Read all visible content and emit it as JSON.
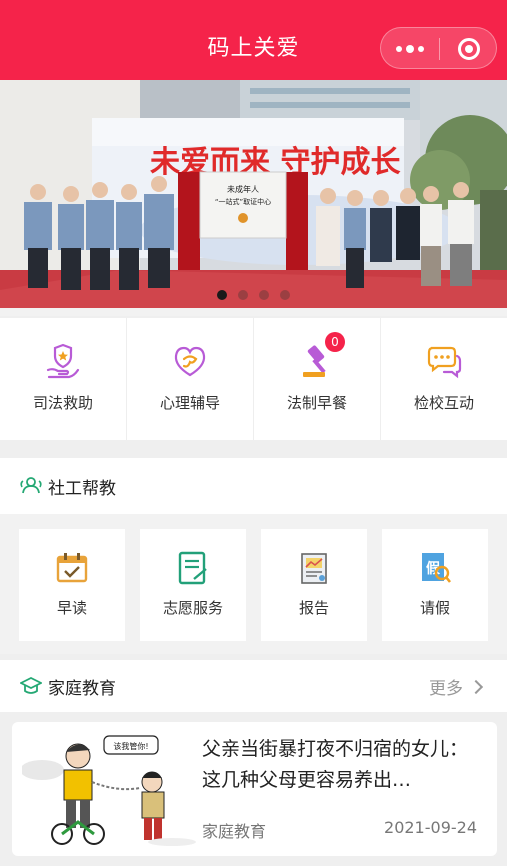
{
  "header": {
    "title": "码上关爱"
  },
  "banner": {
    "slogan": "未爱而来  守护成长",
    "board_line1": "未成年人",
    "board_line2": "“一站式”取证中心",
    "slide_count": 4,
    "active_slide": 1
  },
  "quick_menu": [
    {
      "label": "司法救助",
      "icon": "hand-heart-icon"
    },
    {
      "label": "心理辅导",
      "icon": "heart-chat-icon"
    },
    {
      "label": "法制早餐",
      "icon": "gavel-icon",
      "badge": "0"
    },
    {
      "label": "检校互动",
      "icon": "chat-bubbles-icon"
    }
  ],
  "social_work": {
    "title": "社工帮教",
    "items": [
      {
        "label": "早读",
        "icon": "calendar-icon"
      },
      {
        "label": "志愿服务",
        "icon": "form-icon"
      },
      {
        "label": "报告",
        "icon": "report-icon"
      },
      {
        "label": "请假",
        "icon": "leave-icon"
      }
    ]
  },
  "family_edu": {
    "title": "家庭教育",
    "more": "更多",
    "article": {
      "title": "父亲当街暴打夜不归宿的女儿：这几种父母更容易养出…",
      "tag": "家庭教育",
      "date": "2021-09-24",
      "thumb_bubble": "该我管你!"
    }
  },
  "colors": {
    "brand": "#f5234a",
    "icon_purple": "#b85bd6",
    "icon_gold": "#f0a020"
  }
}
